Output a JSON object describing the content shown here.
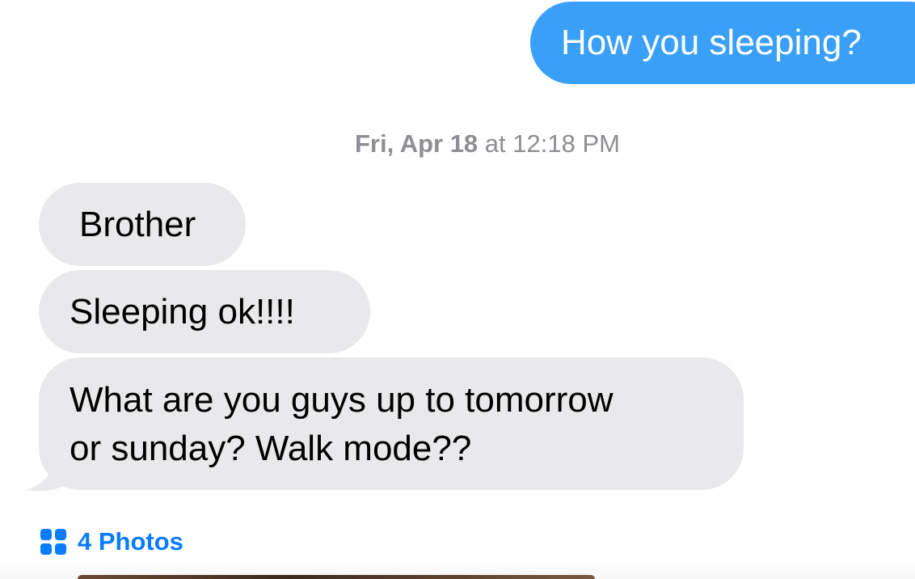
{
  "messages": {
    "sent": [
      {
        "text": "How you sleeping?"
      }
    ],
    "timestamp": {
      "day": "Fri, Apr 18",
      "connector": "at",
      "time": "12:18 PM"
    },
    "received": [
      {
        "text": "Brother"
      },
      {
        "text": "Sleeping ok!!!!"
      },
      {
        "lines": [
          "What are you guys up to tomorrow",
          "or sunday? Walk mode??"
        ]
      }
    ]
  },
  "attachment": {
    "label": "4 Photos",
    "icon": "photo-grid-icon"
  },
  "colors": {
    "sent_bubble": "#3aa0f7",
    "received_bubble": "#e9e9eb",
    "link": "#0a7cff",
    "timestamp": "#8e8e93"
  }
}
